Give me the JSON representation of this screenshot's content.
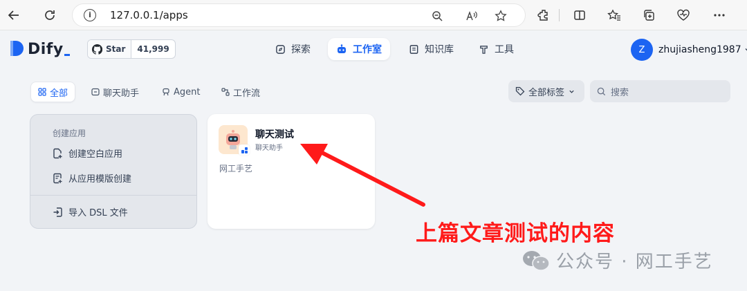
{
  "browser": {
    "url": "127.0.0.1/apps"
  },
  "header": {
    "logo_text": "Dify",
    "github": {
      "star_label": "Star",
      "star_count": "41,999"
    },
    "nav": [
      {
        "label": "探索",
        "icon": "compass-icon",
        "active": false
      },
      {
        "label": "工作室",
        "icon": "robot-icon",
        "active": true
      },
      {
        "label": "知识库",
        "icon": "book-icon",
        "active": false
      },
      {
        "label": "工具",
        "icon": "hammer-icon",
        "active": false
      }
    ],
    "user": {
      "avatar_letter": "Z",
      "name": "zhujiasheng1987"
    }
  },
  "tabs": [
    {
      "label": "全部",
      "active": true
    },
    {
      "label": "聊天助手",
      "active": false
    },
    {
      "label": "Agent",
      "active": false
    },
    {
      "label": "工作流",
      "active": false
    }
  ],
  "filters": {
    "tag_label": "全部标签",
    "search_placeholder": "搜索"
  },
  "create": {
    "title": "创建应用",
    "blank": "创建空白应用",
    "template": "从应用模版创建",
    "import": "导入 DSL 文件"
  },
  "apps": [
    {
      "name": "聊天测试",
      "mode": "聊天助手",
      "description": "网工手艺"
    }
  ],
  "annotation": {
    "text": "上篇文章测试的内容",
    "color": "#ff1a1a"
  },
  "watermark": "公众号 · 网工手艺",
  "colors": {
    "accent": "#1c64f2",
    "background": "#f2f4f7"
  }
}
